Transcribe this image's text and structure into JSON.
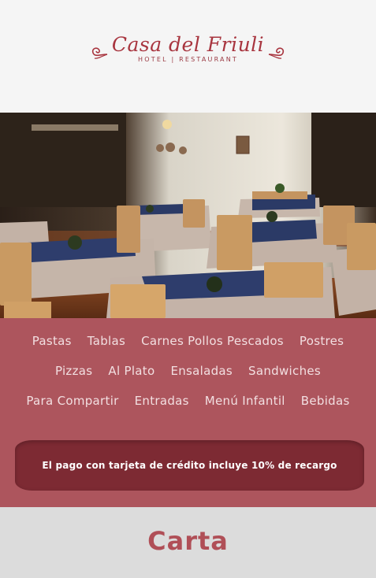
{
  "brand": {
    "name": "Casa del Friuli",
    "tagline": "HOTEL | RESTAURANT",
    "color": "#a8353f"
  },
  "hero": {
    "image_icon": "restaurant-dining-room-photo"
  },
  "menu": {
    "row1": [
      "Pastas",
      "Tablas",
      "Carnes Pollos Pescados",
      "Postres"
    ],
    "row2": [
      "Pizzas",
      "Al Plato",
      "Ensaladas",
      "Sandwiches"
    ],
    "row3": [
      "Para Compartir",
      "Entradas",
      "Menú Infantil",
      "Bebidas"
    ]
  },
  "notice": {
    "text": "El pago con tarjeta de crédito incluye 10% de recargo"
  },
  "footer": {
    "title": "Carta"
  },
  "colors": {
    "menu_bg": "#ad555d",
    "notice_bg": "#7d2a33",
    "footer_bg": "#dcdcdc"
  }
}
